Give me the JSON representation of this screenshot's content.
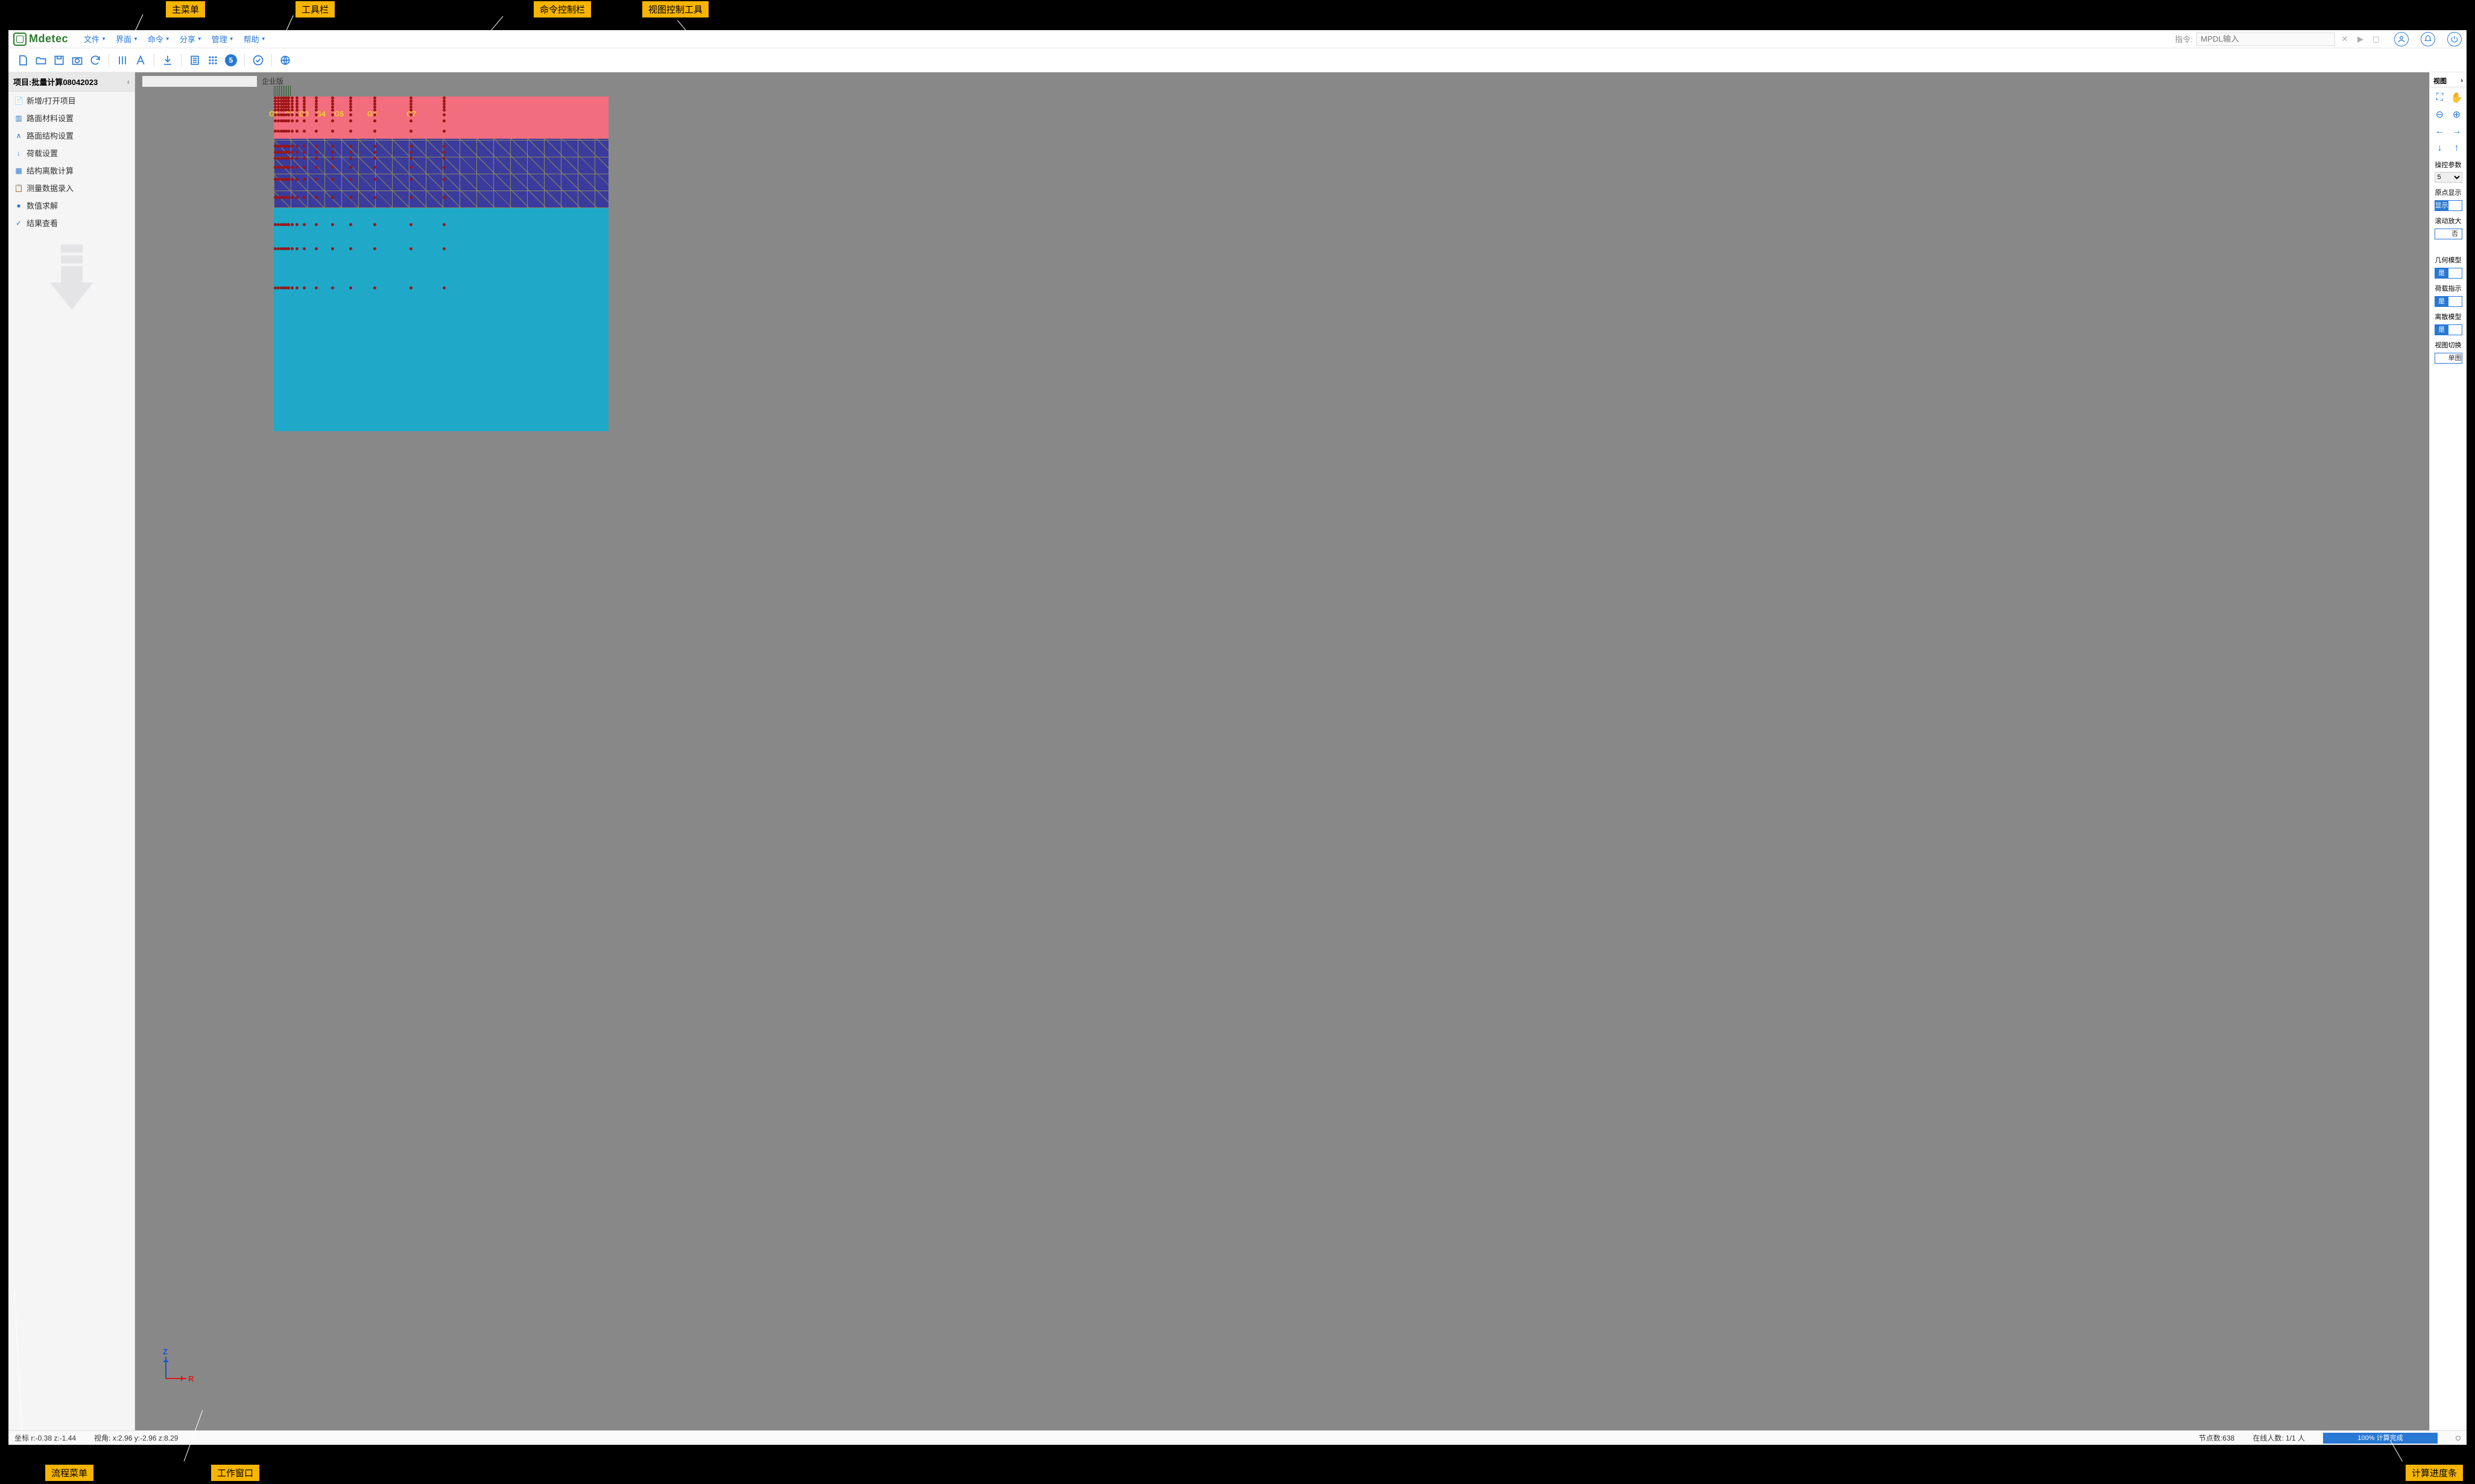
{
  "annotations": {
    "main_menu": "主菜单",
    "toolbar": "工具栏",
    "cmd_bar": "命令控制栏",
    "view_tools": "视图控制工具",
    "flow_menu": "流程菜单",
    "work_window": "工作窗口",
    "progress_bar": "计算进度条"
  },
  "logo": "Mdetec",
  "menus": [
    {
      "label": "文件"
    },
    {
      "label": "界面"
    },
    {
      "label": "命令"
    },
    {
      "label": "分享"
    },
    {
      "label": "管理"
    },
    {
      "label": "帮助"
    }
  ],
  "cmd": {
    "label": "指令:",
    "placeholder": "MPDL输入"
  },
  "toolbar_badge": "5",
  "sidebar": {
    "title": "项目:批量计算08042023",
    "items": [
      {
        "label": "新增/打开项目"
      },
      {
        "label": "路面材料设置"
      },
      {
        "label": "路面结构设置"
      },
      {
        "label": "荷载设置"
      },
      {
        "label": "结构离散计算"
      },
      {
        "label": "测量数据录入"
      },
      {
        "label": "数值求解"
      },
      {
        "label": "结果查看"
      }
    ]
  },
  "canvas": {
    "enterprise": "企业版",
    "axis_z": "Z",
    "axis_r": "R",
    "glabels": [
      "G1",
      "G2",
      "G3",
      "G4",
      "G5",
      "G6",
      "G7"
    ]
  },
  "rightpanel": {
    "title": "视图",
    "params_label": "操控参数",
    "params_value": "5",
    "origin_label": "原点显示",
    "origin_value": "显示",
    "scroll_label": "滚动放大",
    "scroll_value": "否",
    "geom_label": "几何模型",
    "geom_value": "是",
    "load_label": "荷载指示",
    "load_value": "是",
    "disc_label": "离散模型",
    "disc_value": "是",
    "switch_label": "视图切换",
    "switch_value": "单图"
  },
  "status": {
    "coord": "坐标 r:-0.38   z:-1.44",
    "angle": "视角:   x:2.96   y:-2.96   z:8.29",
    "nodes": "节点数:638",
    "online": "在线人数:  1/1 人",
    "progress": "100% 计算完成"
  }
}
